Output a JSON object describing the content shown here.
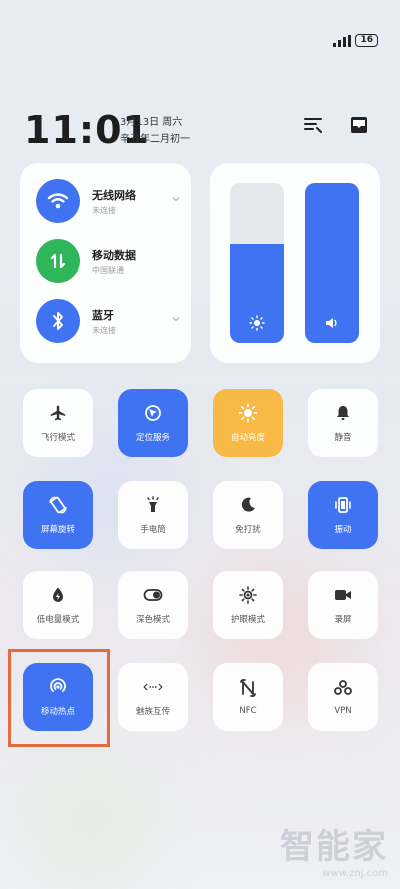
{
  "status": {
    "battery": "16"
  },
  "clock": {
    "time": "11:01",
    "date": "3月13日 周六",
    "lunar": "辛丑年二月初一"
  },
  "top_icons": [
    "edit-list-icon",
    "inbox-icon"
  ],
  "network": [
    {
      "name": "无线网络",
      "sub": "未连接",
      "icon": "wifi-icon",
      "color": "#3f73f2"
    },
    {
      "name": "移动数据",
      "sub": "中国联通",
      "icon": "mobile-data-icon",
      "color": "#2fb55a"
    },
    {
      "name": "蓝牙",
      "sub": "未连接",
      "icon": "bluetooth-icon",
      "color": "#3f73f2"
    }
  ],
  "sliders": {
    "brightness_level": 0.62,
    "volume_level": 1.0
  },
  "tiles": [
    {
      "label": "飞行模式",
      "icon": "airplane-icon",
      "state": "off"
    },
    {
      "label": "定位服务",
      "icon": "location-icon",
      "state": "on"
    },
    {
      "label": "自动亮度",
      "icon": "sun-icon",
      "state": "amber"
    },
    {
      "label": "静音",
      "icon": "bell-icon",
      "state": "off"
    },
    {
      "label": "屏幕旋转",
      "icon": "rotate-icon",
      "state": "on"
    },
    {
      "label": "手电筒",
      "icon": "flashlight-icon",
      "state": "off"
    },
    {
      "label": "免打扰",
      "icon": "moon-icon",
      "state": "off"
    },
    {
      "label": "振动",
      "icon": "vibrate-icon",
      "state": "on"
    },
    {
      "label": "低电量模式",
      "icon": "battery-saver-icon",
      "state": "off"
    },
    {
      "label": "深色模式",
      "icon": "dark-mode-icon",
      "state": "off"
    },
    {
      "label": "护眼模式",
      "icon": "eye-care-icon",
      "state": "off"
    },
    {
      "label": "录屏",
      "icon": "record-screen-icon",
      "state": "off"
    },
    {
      "label": "移动热点",
      "icon": "hotspot-icon",
      "state": "on"
    },
    {
      "label": "魅族互传",
      "icon": "share-icon",
      "state": "off"
    },
    {
      "label": "NFC",
      "icon": "nfc-icon",
      "state": "off"
    },
    {
      "label": "VPN",
      "icon": "vpn-icon",
      "state": "off"
    }
  ],
  "watermark": {
    "title": "智能家",
    "url": "www.znj.com"
  }
}
